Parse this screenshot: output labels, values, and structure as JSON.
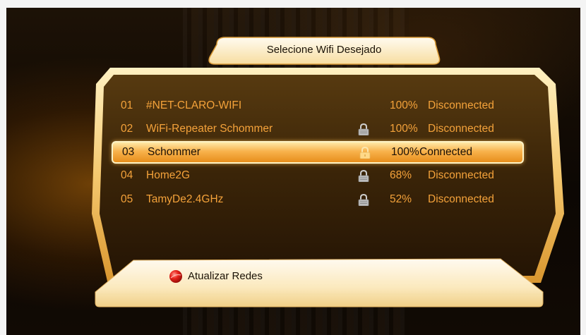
{
  "dialog": {
    "title": "Selecione Wifi Desejado",
    "refresh_label": "Atualizar Redes"
  },
  "networks": [
    {
      "num": "01",
      "ssid": "#NET-CLARO-WIFI",
      "locked": false,
      "signal": "100%",
      "status": "Disconnected",
      "selected": false
    },
    {
      "num": "02",
      "ssid": "WiFi-Repeater Schommer",
      "locked": true,
      "signal": "100%",
      "status": "Disconnected",
      "selected": false
    },
    {
      "num": "03",
      "ssid": "Schommer",
      "locked": true,
      "signal": "100%",
      "status": "Connected",
      "selected": true
    },
    {
      "num": "04",
      "ssid": "Home2G",
      "locked": true,
      "signal": "68%",
      "status": "Disconnected",
      "selected": false
    },
    {
      "num": "05",
      "ssid": "TamyDe2.4GHz",
      "locked": true,
      "signal": "52%",
      "status": "Disconnected",
      "selected": false
    }
  ],
  "colors": {
    "list_text": "#f4a23a",
    "highlight": "#f8b24c",
    "panel_cream": "#fbe8b8"
  },
  "icons": {
    "lock": "padlock-icon",
    "refresh": "red-ball-icon"
  }
}
